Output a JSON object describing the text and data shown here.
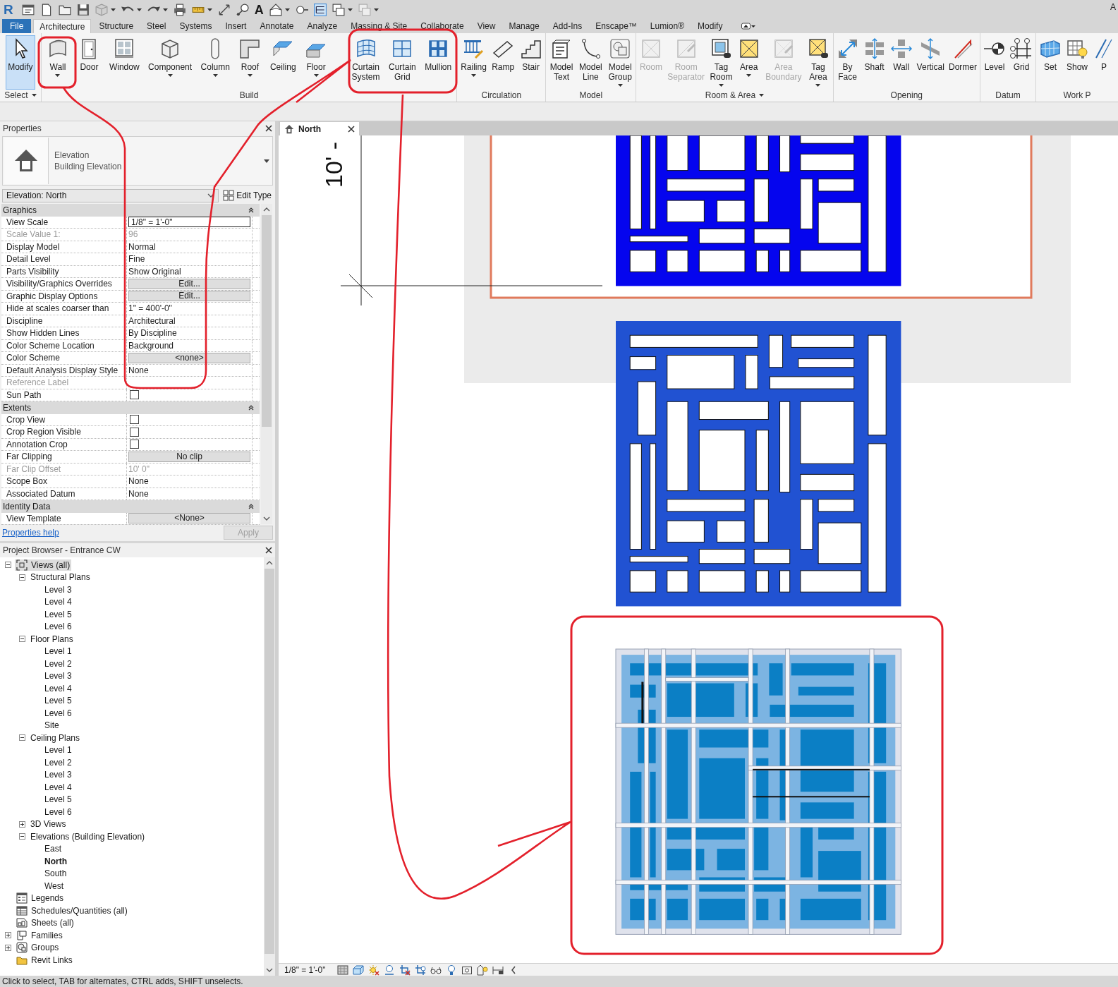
{
  "app": {
    "logo": "R",
    "text_tool": "A",
    "corner_text": "A"
  },
  "ribbon_tabs": [
    {
      "label": "File",
      "kind": "file",
      "selected": false
    },
    {
      "label": "Architecture",
      "kind": "tab",
      "selected": true
    },
    {
      "label": "Structure",
      "kind": "tab",
      "selected": false
    },
    {
      "label": "Steel",
      "kind": "tab",
      "selected": false
    },
    {
      "label": "Systems",
      "kind": "tab",
      "selected": false
    },
    {
      "label": "Insert",
      "kind": "tab",
      "selected": false
    },
    {
      "label": "Annotate",
      "kind": "tab",
      "selected": false
    },
    {
      "label": "Analyze",
      "kind": "tab",
      "selected": false
    },
    {
      "label": "Massing & Site",
      "kind": "tab",
      "selected": false
    },
    {
      "label": "Collaborate",
      "kind": "tab",
      "selected": false
    },
    {
      "label": "View",
      "kind": "tab",
      "selected": false
    },
    {
      "label": "Manage",
      "kind": "tab",
      "selected": false
    },
    {
      "label": "Add-Ins",
      "kind": "tab",
      "selected": false
    },
    {
      "label": "Enscape™",
      "kind": "tab",
      "selected": false
    },
    {
      "label": "Lumion®",
      "kind": "tab",
      "selected": false
    },
    {
      "label": "Modify",
      "kind": "tab",
      "selected": false
    }
  ],
  "ribbon_panels": [
    {
      "label": "Select",
      "dropdown": true,
      "buttons": [
        {
          "label": "Modify",
          "selected": true,
          "disabled": false,
          "dropdown": false
        }
      ]
    },
    {
      "label": "Build",
      "dropdown": false,
      "buttons": [
        {
          "label": "Wall",
          "selected": false,
          "disabled": false,
          "dropdown": true
        },
        {
          "label": "Door",
          "selected": false,
          "disabled": false,
          "dropdown": false
        },
        {
          "label": "Window",
          "selected": false,
          "disabled": false,
          "dropdown": false
        },
        {
          "label": "Component",
          "selected": false,
          "disabled": false,
          "dropdown": true
        },
        {
          "label": "Column",
          "selected": false,
          "disabled": false,
          "dropdown": true
        },
        {
          "label": "Roof",
          "selected": false,
          "disabled": false,
          "dropdown": true
        },
        {
          "label": "Ceiling",
          "selected": false,
          "disabled": false,
          "dropdown": false
        },
        {
          "label": "Floor",
          "selected": false,
          "disabled": false,
          "dropdown": true
        },
        {
          "label": "Curtain System",
          "selected": false,
          "disabled": false,
          "dropdown": false
        },
        {
          "label": "Curtain Grid",
          "selected": false,
          "disabled": false,
          "dropdown": false
        },
        {
          "label": "Mullion",
          "selected": false,
          "disabled": false,
          "dropdown": false
        }
      ]
    },
    {
      "label": "Circulation",
      "dropdown": false,
      "buttons": [
        {
          "label": "Railing",
          "selected": false,
          "disabled": false,
          "dropdown": true
        },
        {
          "label": "Ramp",
          "selected": false,
          "disabled": false,
          "dropdown": false
        },
        {
          "label": "Stair",
          "selected": false,
          "disabled": false,
          "dropdown": false
        }
      ]
    },
    {
      "label": "Model",
      "dropdown": false,
      "buttons": [
        {
          "label": "Model Text",
          "selected": false,
          "disabled": false,
          "dropdown": false
        },
        {
          "label": "Model Line",
          "selected": false,
          "disabled": false,
          "dropdown": false
        },
        {
          "label": "Model Group",
          "selected": false,
          "disabled": false,
          "dropdown": true
        }
      ]
    },
    {
      "label": "Room & Area",
      "dropdown": true,
      "buttons": [
        {
          "label": "Room",
          "selected": false,
          "disabled": true,
          "dropdown": false
        },
        {
          "label": "Room Separator",
          "selected": false,
          "disabled": true,
          "dropdown": false
        },
        {
          "label": "Tag Room",
          "selected": false,
          "disabled": false,
          "dropdown": true
        },
        {
          "label": "Area",
          "selected": false,
          "disabled": false,
          "dropdown": true
        },
        {
          "label": "Area Boundary",
          "selected": false,
          "disabled": true,
          "dropdown": false
        },
        {
          "label": "Tag Area",
          "selected": false,
          "disabled": false,
          "dropdown": true
        }
      ]
    },
    {
      "label": "Opening",
      "dropdown": false,
      "buttons": [
        {
          "label": "By Face",
          "selected": false,
          "disabled": false,
          "dropdown": false
        },
        {
          "label": "Shaft",
          "selected": false,
          "disabled": false,
          "dropdown": false
        },
        {
          "label": "Wall",
          "selected": false,
          "disabled": false,
          "dropdown": false
        },
        {
          "label": "Vertical",
          "selected": false,
          "disabled": false,
          "dropdown": false
        },
        {
          "label": "Dormer",
          "selected": false,
          "disabled": false,
          "dropdown": false
        }
      ]
    },
    {
      "label": "Datum",
      "dropdown": false,
      "buttons": [
        {
          "label": "Level",
          "selected": false,
          "disabled": false,
          "dropdown": false
        },
        {
          "label": "Grid",
          "selected": false,
          "disabled": false,
          "dropdown": false
        }
      ]
    },
    {
      "label": "Work P",
      "dropdown": false,
      "buttons": [
        {
          "label": "Set",
          "selected": false,
          "disabled": false,
          "dropdown": false
        },
        {
          "label": "Show",
          "selected": false,
          "disabled": false,
          "dropdown": false
        },
        {
          "label": "P",
          "selected": false,
          "disabled": false,
          "dropdown": false
        }
      ]
    }
  ],
  "properties": {
    "title": "Properties",
    "type_family": "Elevation",
    "type_name": "Building Elevation",
    "instance": "Elevation: North",
    "edit_type": "Edit Type",
    "groups": [
      {
        "name": "Graphics",
        "expanded": true,
        "rows": [
          {
            "name": "View Scale",
            "value": "1/8\" = 1'-0\"",
            "kind": "input",
            "disabled": false
          },
          {
            "name": "Scale Value 1:",
            "value": "96",
            "kind": "text",
            "disabled": true
          },
          {
            "name": "Display Model",
            "value": "Normal",
            "kind": "text",
            "disabled": false
          },
          {
            "name": "Detail Level",
            "value": "Fine",
            "kind": "text",
            "disabled": false
          },
          {
            "name": "Parts Visibility",
            "value": "Show Original",
            "kind": "text",
            "disabled": false
          },
          {
            "name": "Visibility/Graphics Overrides",
            "value": "Edit...",
            "kind": "button",
            "disabled": false
          },
          {
            "name": "Graphic Display Options",
            "value": "Edit...",
            "kind": "button",
            "disabled": false
          },
          {
            "name": "Hide at scales coarser than",
            "value": "1\" = 400'-0\"",
            "kind": "text",
            "disabled": false
          },
          {
            "name": "Discipline",
            "value": "Architectural",
            "kind": "text",
            "disabled": false
          },
          {
            "name": "Show Hidden Lines",
            "value": "By Discipline",
            "kind": "text",
            "disabled": false
          },
          {
            "name": "Color Scheme Location",
            "value": "Background",
            "kind": "text",
            "disabled": false
          },
          {
            "name": "Color Scheme",
            "value": "<none>",
            "kind": "button",
            "disabled": false
          },
          {
            "name": "Default Analysis Display Style",
            "value": "None",
            "kind": "text",
            "disabled": false
          },
          {
            "name": "Reference Label",
            "kind": "text",
            "disabled": true
          },
          {
            "name": "Sun Path",
            "kind": "checkbox",
            "checked": false,
            "disabled": false
          }
        ]
      },
      {
        "name": "Extents",
        "expanded": true,
        "rows": [
          {
            "name": "Crop View",
            "kind": "checkbox",
            "checked": false,
            "disabled": false
          },
          {
            "name": "Crop Region Visible",
            "kind": "checkbox",
            "checked": false,
            "disabled": false
          },
          {
            "name": "Annotation Crop",
            "kind": "checkbox",
            "checked": false,
            "disabled": false
          },
          {
            "name": "Far Clipping",
            "value": "No clip",
            "kind": "button",
            "disabled": false
          },
          {
            "name": "Far Clip Offset",
            "value": "10' 0\"",
            "kind": "text",
            "disabled": true
          },
          {
            "name": "Scope Box",
            "value": "None",
            "kind": "text",
            "disabled": false
          },
          {
            "name": "Associated Datum",
            "value": "None",
            "kind": "text",
            "disabled": false
          }
        ]
      },
      {
        "name": "Identity Data",
        "expanded": true,
        "rows": [
          {
            "name": "View Template",
            "value": "<None>",
            "kind": "button",
            "disabled": false
          }
        ]
      }
    ],
    "help_link": "Properties help",
    "apply": {
      "label": "Apply",
      "disabled": true
    }
  },
  "project_browser": {
    "title": "Project Browser - Entrance CW",
    "tree": [
      {
        "label": "Views (all)",
        "kind": "views",
        "expanded": true,
        "selected": true,
        "children": [
          {
            "label": "Structural Plans",
            "expanded": true,
            "selected": false,
            "children": [
              {
                "label": "Level 3",
                "selected": false
              },
              {
                "label": "Level 4",
                "selected": false
              },
              {
                "label": "Level 5",
                "selected": false
              },
              {
                "label": "Level 6",
                "selected": false
              }
            ]
          },
          {
            "label": "Floor Plans",
            "expanded": true,
            "selected": false,
            "children": [
              {
                "label": "Level 1",
                "selected": false
              },
              {
                "label": "Level 2",
                "selected": false
              },
              {
                "label": "Level 3",
                "selected": false
              },
              {
                "label": "Level 4",
                "selected": false
              },
              {
                "label": "Level 5",
                "selected": false
              },
              {
                "label": "Level 6",
                "selected": false
              },
              {
                "label": "Site",
                "selected": false
              }
            ]
          },
          {
            "label": "Ceiling Plans",
            "expanded": true,
            "selected": false,
            "children": [
              {
                "label": "Level 1",
                "selected": false
              },
              {
                "label": "Level 2",
                "selected": false
              },
              {
                "label": "Level 3",
                "selected": false
              },
              {
                "label": "Level 4",
                "selected": false
              },
              {
                "label": "Level 5",
                "selected": false
              },
              {
                "label": "Level 6",
                "selected": false
              }
            ]
          },
          {
            "label": "3D Views",
            "expanded": false,
            "selected": false
          },
          {
            "label": "Elevations (Building Elevation)",
            "expanded": true,
            "selected": false,
            "children": [
              {
                "label": "East",
                "selected": false,
                "current": false
              },
              {
                "label": "North",
                "selected": false,
                "current": true
              },
              {
                "label": "South",
                "selected": false,
                "current": false
              },
              {
                "label": "West",
                "selected": false,
                "current": false
              }
            ]
          }
        ]
      },
      {
        "label": "Legends",
        "kind": "legends",
        "selected": false
      },
      {
        "label": "Schedules/Quantities (all)",
        "kind": "schedules",
        "selected": false
      },
      {
        "label": "Sheets (all)",
        "kind": "sheets",
        "selected": false
      },
      {
        "label": "Families",
        "kind": "families",
        "expanded": false,
        "selected": false
      },
      {
        "label": "Groups",
        "kind": "groups",
        "expanded": false,
        "selected": false
      },
      {
        "label": "Revit Links",
        "kind": "links",
        "selected": false
      }
    ]
  },
  "view": {
    "tab": "North",
    "dimension_label": "10' -",
    "scale": "1/8\" = 1'-0\""
  },
  "status_bar": "Click to select, TAB for alternates, CTRL adds, SHIFT unselects."
}
